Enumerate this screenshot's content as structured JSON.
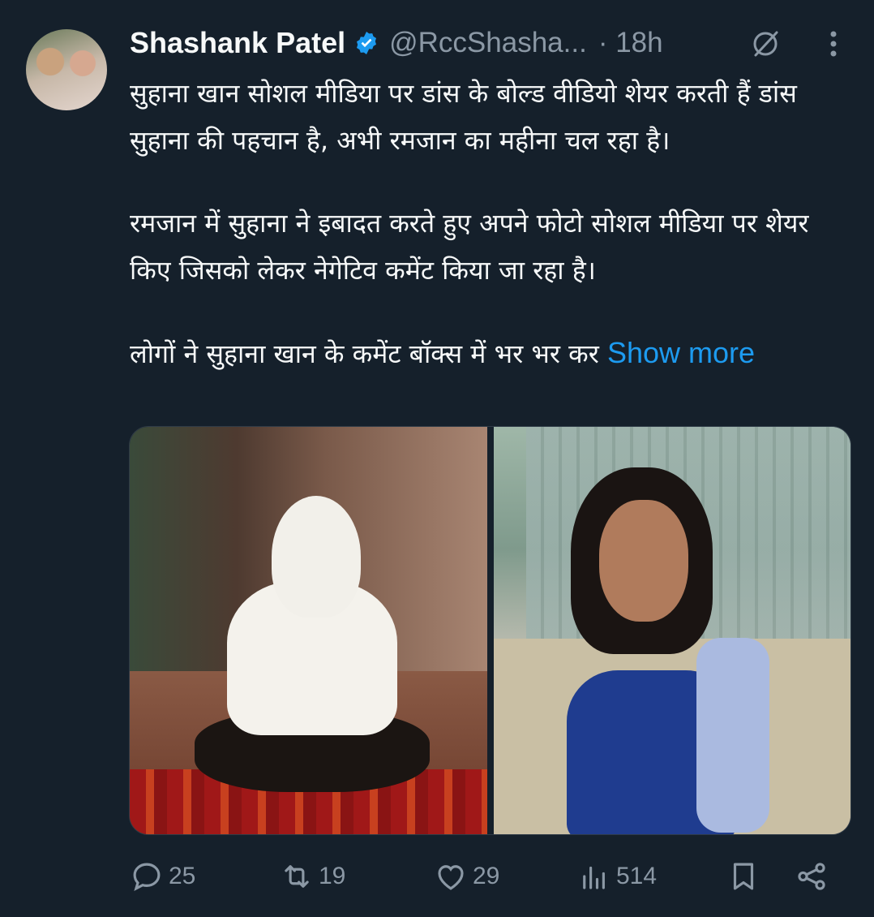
{
  "author": {
    "name": "Shashank Patel",
    "handle": "@RccShasha...",
    "time": "· 18h"
  },
  "tweet": {
    "paragraphs": [
      "सुहाना खान सोशल मीडिया पर डांस के बोल्ड वीडियो शेयर करती हैं डांस सुहाना की पहचान है, अभी रमजान का महीना चल रहा है।",
      "रमजान में सुहाना ने इबादत करते हुए अपने फोटो सोशल मीडिया पर शेयर किए जिसको लेकर नेगेटिव कमेंट किया जा रहा है।",
      "लोगों ने सुहाना खान के कमेंट बॉक्स में भर भर कर"
    ],
    "show_more": "Show more"
  },
  "actions": {
    "replies": "25",
    "reposts": "19",
    "likes": "29",
    "views": "514"
  },
  "colors": {
    "background": "#15202b",
    "accent": "#1d9bf0",
    "muted": "#8b98a5",
    "text": "#f7f9f9"
  },
  "icons": [
    "verified-badge-icon",
    "grok-icon",
    "more-vertical-icon",
    "reply-icon",
    "repost-icon",
    "like-icon",
    "views-icon",
    "bookmark-icon",
    "share-icon"
  ]
}
